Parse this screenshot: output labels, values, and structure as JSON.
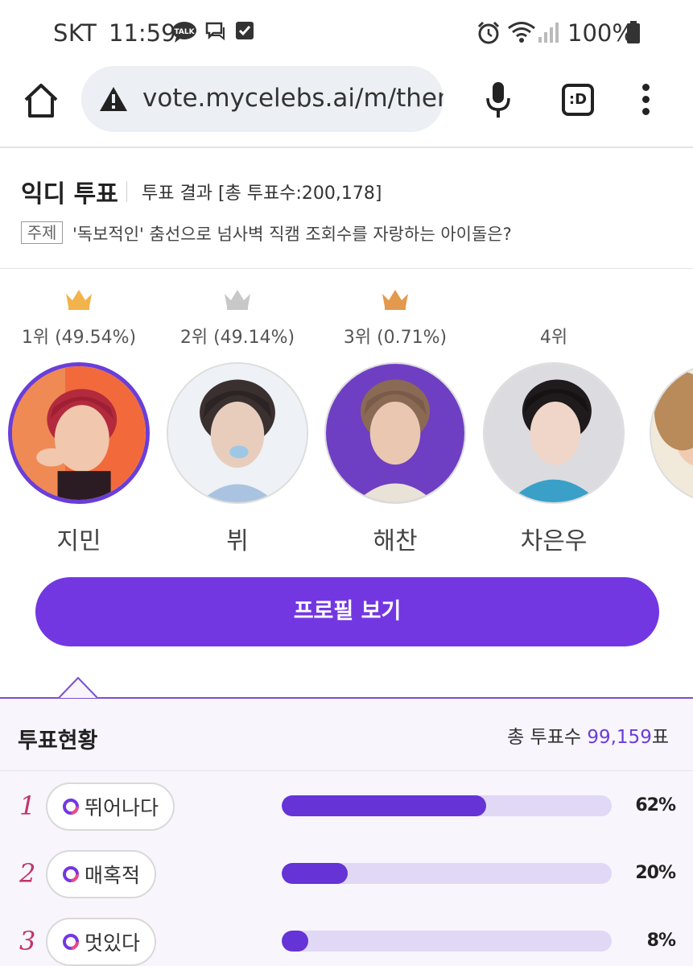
{
  "status_bar": {
    "carrier": "SKT",
    "time": "11:59",
    "battery": "100%"
  },
  "browser": {
    "url": "vote.mycelebs.ai/m/ther",
    "extension_label": ":D"
  },
  "header": {
    "title": "익디 투표",
    "result_text": "투표 결과 [총 투표수:200,178]",
    "topic_tag": "주제",
    "topic_text": "'독보적인' 춤선으로 넘사벽 직캠 조회수를 자랑하는 아이돌은?"
  },
  "candidates": [
    {
      "rank": "1위 (49.54%)",
      "name": "지민",
      "crown": "gold",
      "selected": true
    },
    {
      "rank": "2위 (49.14%)",
      "name": "뷔",
      "crown": "silver",
      "selected": false
    },
    {
      "rank": "3위 (0.71%)",
      "name": "해찬",
      "crown": "bronze",
      "selected": false
    },
    {
      "rank": "4위",
      "name": "차은우",
      "crown": "none",
      "selected": false
    }
  ],
  "profile_button": "프로필 보기",
  "vote_status": {
    "title": "투표현황",
    "total_label": "총 투표수",
    "total_value": "99,159",
    "total_unit": "표",
    "rows": [
      {
        "rank": "1",
        "label": "뛰어나다",
        "percent": 62,
        "percent_text": "62%"
      },
      {
        "rank": "2",
        "label": "매혹적",
        "percent": 20,
        "percent_text": "20%"
      },
      {
        "rank": "3",
        "label": "멋있다",
        "percent": 8,
        "percent_text": "8%"
      }
    ]
  },
  "colors": {
    "accent": "#7337e2",
    "bar_fill": "#6533d6",
    "bar_track": "#e1d8f6",
    "rank_number": "#c0356b",
    "crown_gold": "#f2b34c",
    "crown_silver": "#c8c8c8",
    "crown_bronze": "#e39a4e"
  }
}
